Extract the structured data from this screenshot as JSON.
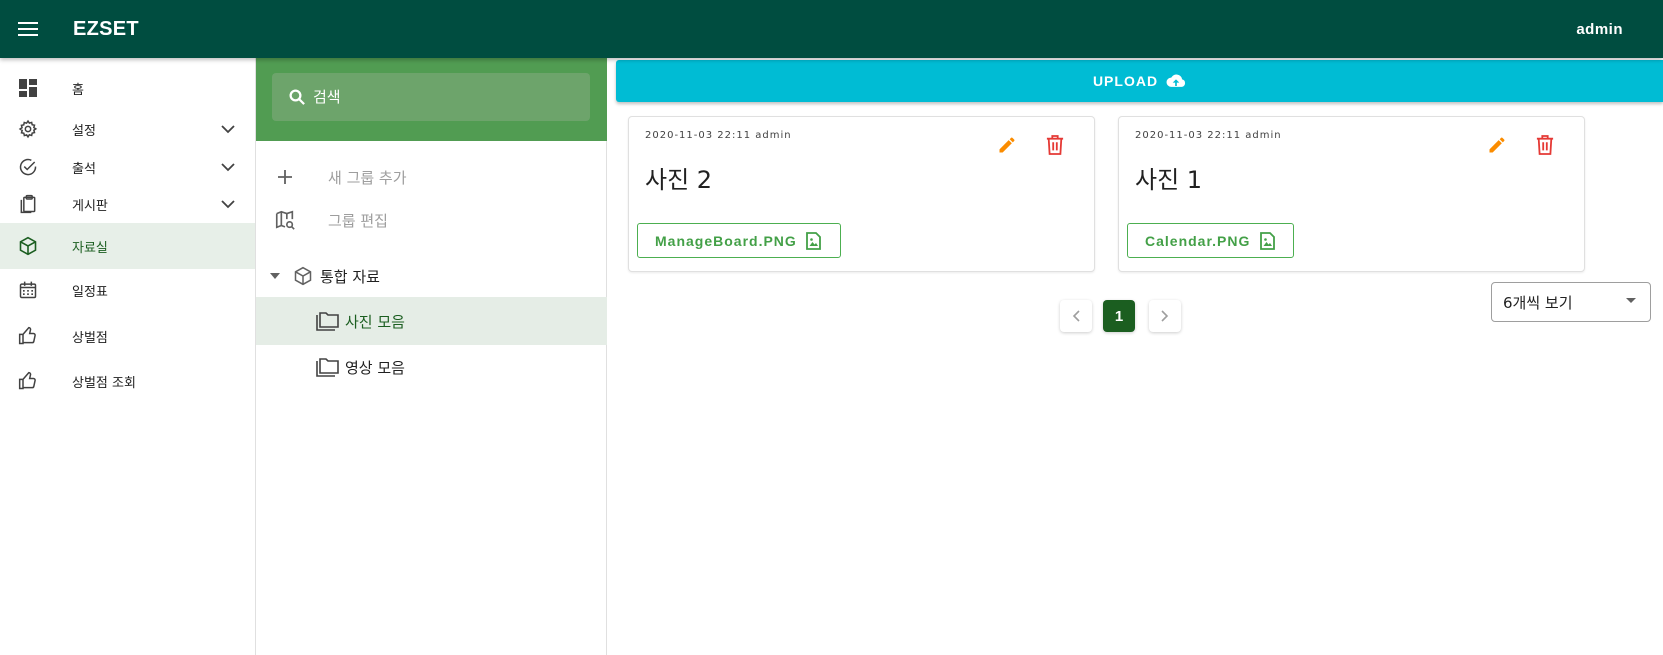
{
  "appbar": {
    "title": "EZSET",
    "user": "admin"
  },
  "nav": {
    "items": [
      {
        "label": "홈",
        "icon": "dashboard-icon",
        "expandable": false
      },
      {
        "label": "설정",
        "icon": "gear-icon",
        "expandable": true
      },
      {
        "label": "출석",
        "icon": "check-circle-icon",
        "expandable": true
      },
      {
        "label": "게시판",
        "icon": "clipboard-icon",
        "expandable": true
      },
      {
        "label": "자료실",
        "icon": "cube-icon",
        "expandable": false,
        "active": true
      },
      {
        "label": "일정표",
        "icon": "calendar-icon",
        "expandable": false
      },
      {
        "label": "상벌점",
        "icon": "thumb-up-icon",
        "expandable": false
      },
      {
        "label": "상벌점 조회",
        "icon": "thumb-up-icon",
        "expandable": false
      }
    ]
  },
  "groups": {
    "search_placeholder": "검색",
    "add_group_label": "새 그룹 추가",
    "edit_group_label": "그룹 편집",
    "root_label": "통합 자료",
    "folders": [
      {
        "label": "사진 모음",
        "active": true
      },
      {
        "label": "영상 모음",
        "active": false
      }
    ]
  },
  "main": {
    "upload_label": "UPLOAD",
    "cards": [
      {
        "meta": "2020-11-03 22:11 admin",
        "title": "사진 2",
        "file": "ManageBoard.PNG"
      },
      {
        "meta": "2020-11-03 22:11 admin",
        "title": "사진 1",
        "file": "Calendar.PNG"
      }
    ],
    "pagination": {
      "current_page": "1"
    },
    "per_page_label": "6개씩 보기"
  },
  "colors": {
    "appbar": "#004d40",
    "search_area": "#519c52",
    "upload": "#00bcd4",
    "edit": "#fb8c00",
    "delete": "#e53935",
    "file_green": "#43a047",
    "page_active": "#1b5e20"
  }
}
